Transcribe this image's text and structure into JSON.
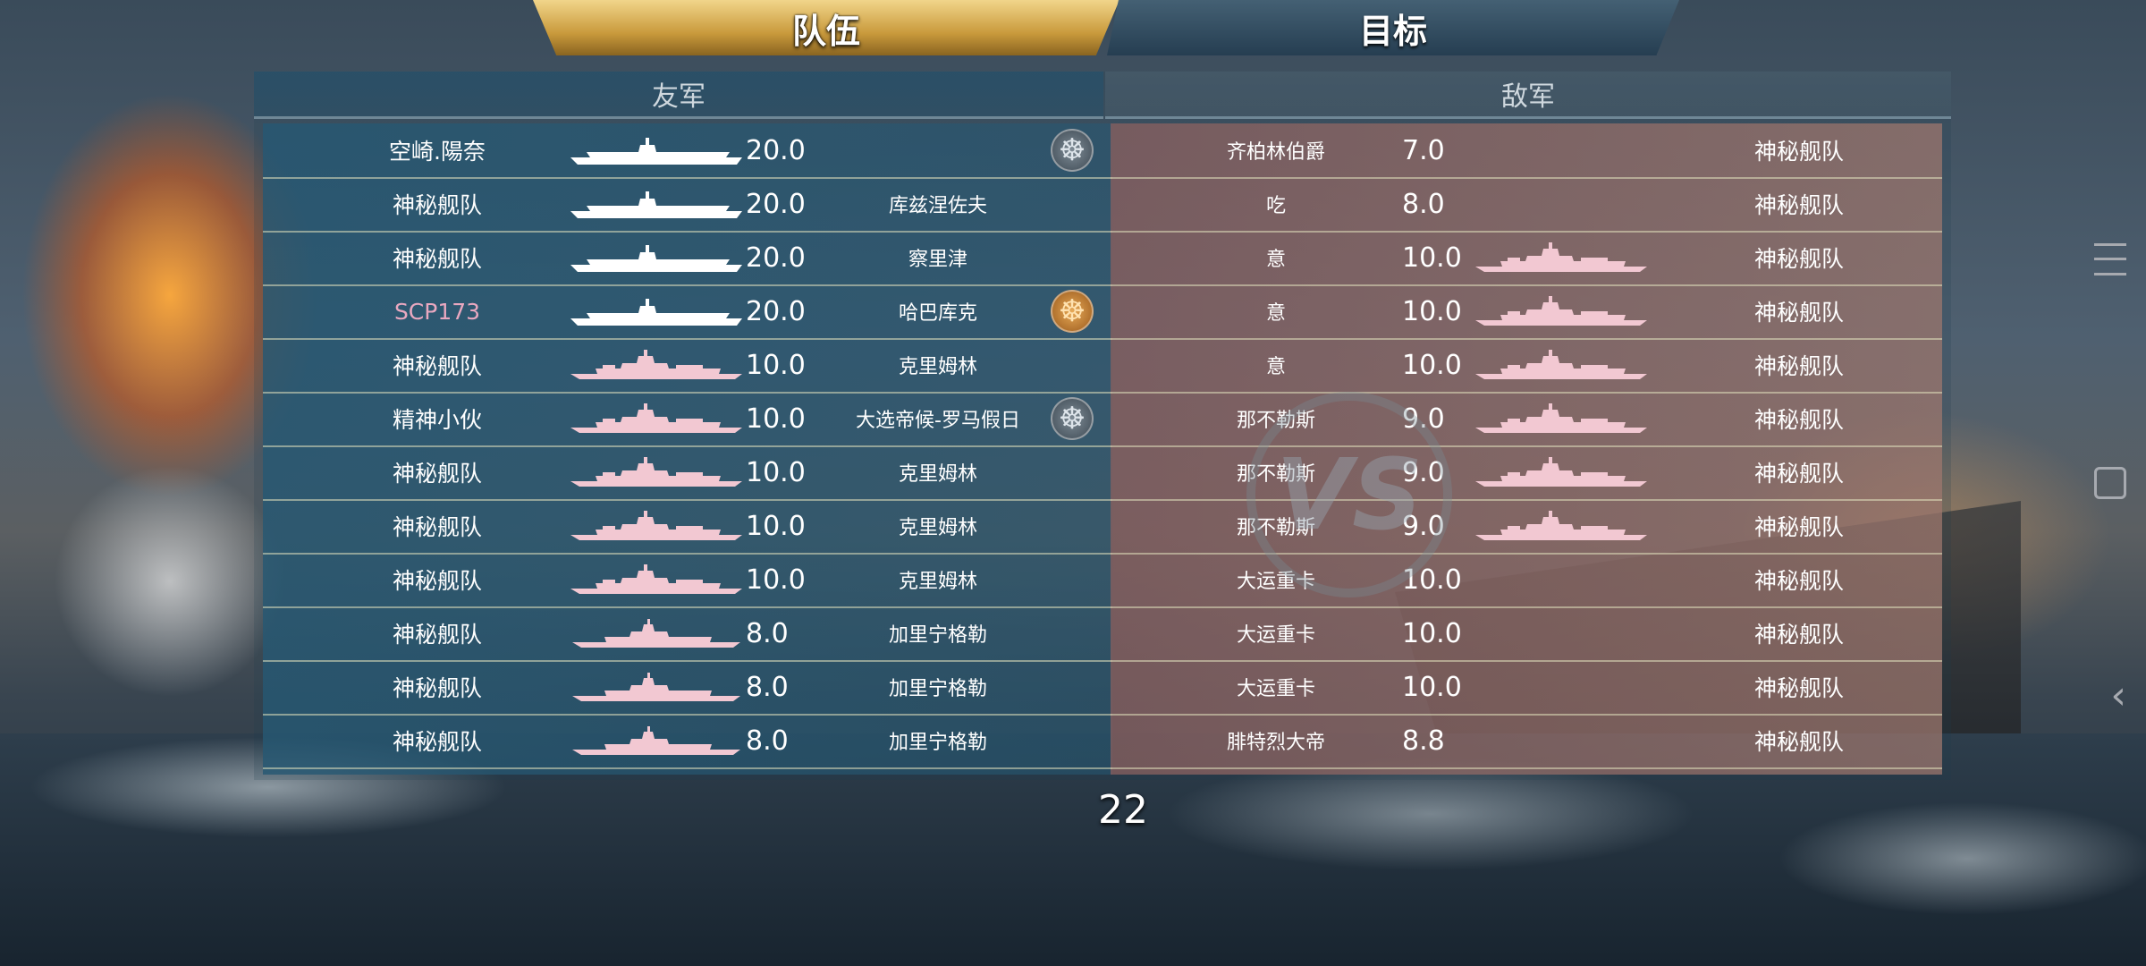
{
  "tabs": {
    "team": "队伍",
    "target": "目标"
  },
  "headers": {
    "friend": "友军",
    "enemy": "敌军"
  },
  "countdown": "22",
  "vs_text": "VS",
  "colors": {
    "friend_panel": "#26587380",
    "enemy_panel": "#8c605f",
    "pink_name": "#e9a8c0",
    "red_name": "#ff3535",
    "silhouette_white": "#ffffff",
    "silhouette_pink": "#f2c8d2"
  },
  "friendly": [
    {
      "player": "空崎.陽奈",
      "ship_icon": "carrier-silhouette-icon",
      "value": "20.0",
      "ship": "",
      "badge": "ship-wheel-steel-icon"
    },
    {
      "player": "神秘舰队",
      "ship_icon": "carrier-silhouette-icon",
      "value": "20.0",
      "ship": "库兹涅佐夫",
      "badge": ""
    },
    {
      "player": "神秘舰队",
      "ship_icon": "carrier-silhouette-icon",
      "value": "20.0",
      "ship": "察里津",
      "badge": ""
    },
    {
      "player": "SCP173",
      "ship_icon": "carrier-silhouette-icon",
      "value": "20.0",
      "ship": "哈巴库克",
      "badge": "ship-wheel-bronze-icon"
    },
    {
      "player": "神秘舰队",
      "ship_icon": "battleship-silhouette-icon",
      "value": "10.0",
      "ship": "克里姆林",
      "badge": ""
    },
    {
      "player": "精神小伙",
      "ship_icon": "battleship-silhouette-icon",
      "value": "10.0",
      "ship": "大选帝候-罗马假日",
      "badge": "ship-wheel-steel-icon"
    },
    {
      "player": "神秘舰队",
      "ship_icon": "battleship-silhouette-icon",
      "value": "10.0",
      "ship": "克里姆林",
      "badge": ""
    },
    {
      "player": "神秘舰队",
      "ship_icon": "battleship-silhouette-icon",
      "value": "10.0",
      "ship": "克里姆林",
      "badge": ""
    },
    {
      "player": "神秘舰队",
      "ship_icon": "battleship-silhouette-icon",
      "value": "10.0",
      "ship": "克里姆林",
      "badge": ""
    },
    {
      "player": "神秘舰队",
      "ship_icon": "cruiser-silhouette-icon",
      "value": "8.0",
      "ship": "加里宁格勒",
      "badge": ""
    },
    {
      "player": "神秘舰队",
      "ship_icon": "cruiser-silhouette-icon",
      "value": "8.0",
      "ship": "加里宁格勒",
      "badge": ""
    },
    {
      "player": "神秘舰队",
      "ship_icon": "cruiser-silhouette-icon",
      "value": "8.0",
      "ship": "加里宁格勒",
      "badge": ""
    }
  ],
  "enemy": [
    {
      "ship": "齐柏林伯爵",
      "value": "7.0",
      "ship_icon": "",
      "player": "神秘舰队"
    },
    {
      "ship": "吃",
      "value": "8.0",
      "ship_icon": "",
      "player": "神秘舰队"
    },
    {
      "ship": "意",
      "value": "10.0",
      "ship_icon": "battleship-silhouette-icon",
      "player": "神秘舰队"
    },
    {
      "ship": "意",
      "value": "10.0",
      "ship_icon": "battleship-silhouette-icon",
      "player": "神秘舰队"
    },
    {
      "ship": "意",
      "value": "10.0",
      "ship_icon": "battleship-silhouette-icon",
      "player": "神秘舰队"
    },
    {
      "ship": "那不勒斯",
      "value": "9.0",
      "ship_icon": "battleship-silhouette-icon",
      "player": "神秘舰队"
    },
    {
      "ship": "那不勒斯",
      "value": "9.0",
      "ship_icon": "battleship-silhouette-icon",
      "player": "神秘舰队"
    },
    {
      "ship": "那不勒斯",
      "value": "9.0",
      "ship_icon": "battleship-silhouette-icon",
      "player": "神秘舰队"
    },
    {
      "ship": "大运重卡",
      "value": "10.0",
      "ship_icon": "",
      "player": "神秘舰队"
    },
    {
      "ship": "大运重卡",
      "value": "10.0",
      "ship_icon": "",
      "player": "神秘舰队"
    },
    {
      "ship": "大运重卡",
      "value": "10.0",
      "ship_icon": "",
      "player": "神秘舰队"
    },
    {
      "ship": "腓特烈大帝",
      "value": "8.8",
      "ship_icon": "",
      "player": "神秘舰队"
    }
  ],
  "nav": {
    "menu": "menu-lines-icon",
    "home": "home-square-icon",
    "back": "back-chevron-icon"
  }
}
